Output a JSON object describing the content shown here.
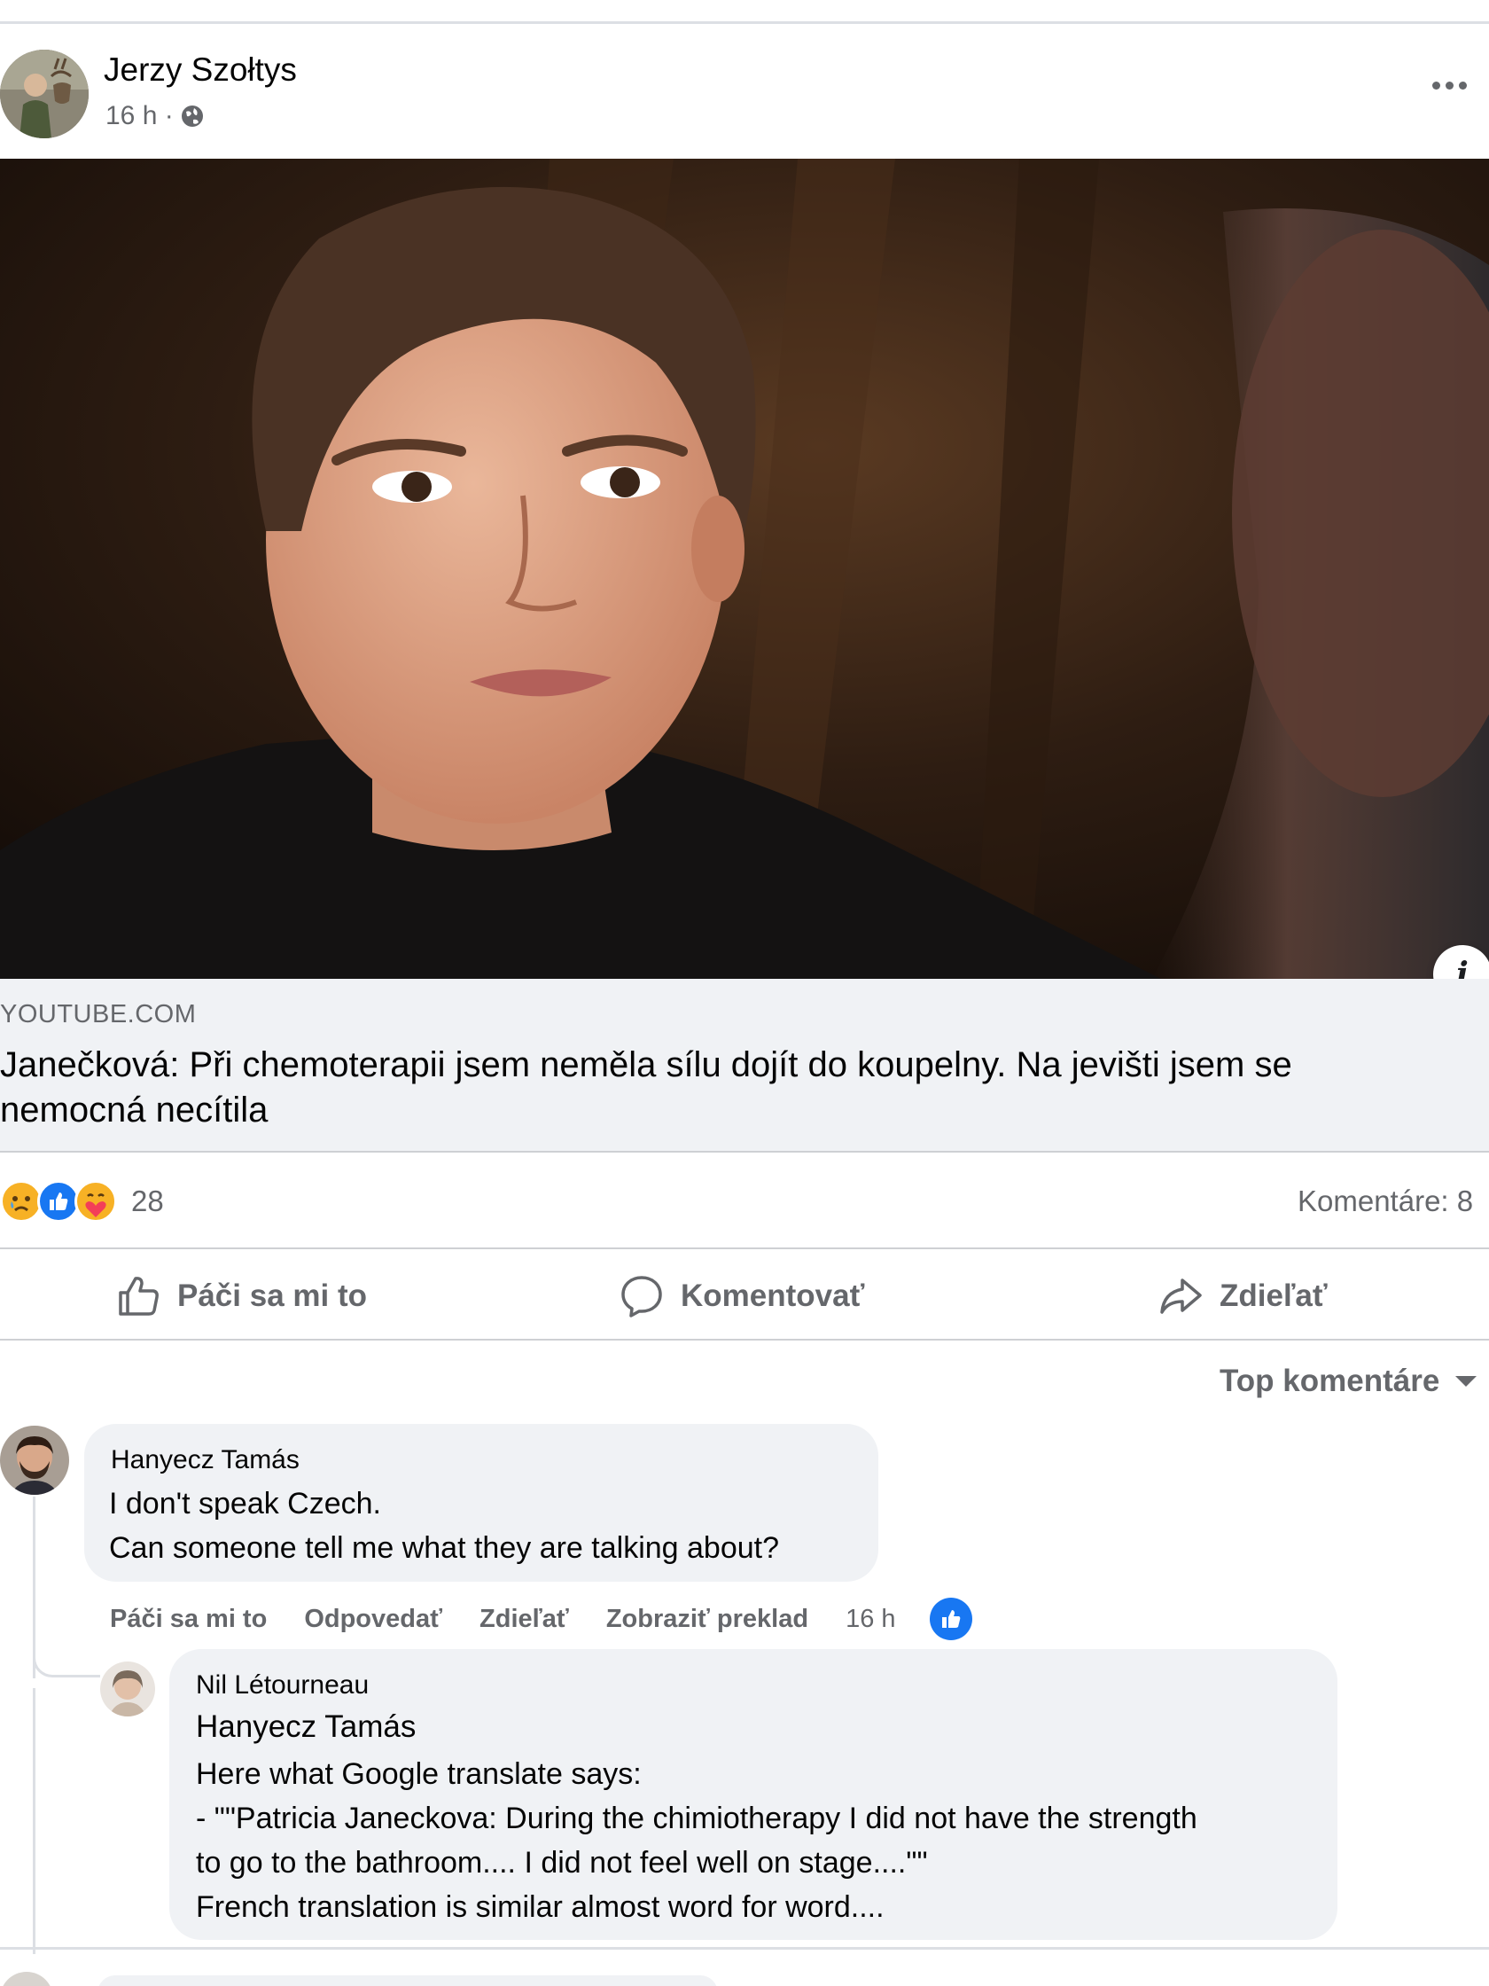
{
  "post": {
    "author": "Jerzy Szołtys",
    "time": "16 h ·",
    "privacy_icon": "globe-icon"
  },
  "link": {
    "domain": "YOUTUBE.COM",
    "title_line1": "Janečková: Při chemoterapii jsem neměla sílu dojít do koupelny. Na jevišti jsem se",
    "title_line2": "nemocná necítila"
  },
  "stats": {
    "reaction_icons": [
      "sad-reaction-icon",
      "like-reaction-icon",
      "care-reaction-icon"
    ],
    "reaction_count": "28",
    "comments_label": "Komentáre: 8"
  },
  "actions": {
    "like": "Páči sa mi to",
    "comment": "Komentovať",
    "share": "Zdieľať"
  },
  "sort_label": "Top komentáre",
  "comments": [
    {
      "author": "Hanyecz Tamás",
      "lines": [
        "I don't speak Czech.",
        "Can someone tell me what they are talking about?"
      ],
      "actions": {
        "like": "Páči sa mi to",
        "reply": "Odpovedať",
        "share": "Zdieľať",
        "translate": "Zobraziť preklad",
        "time": "16 h"
      }
    },
    {
      "author": "Nil Létourneau",
      "mention": "Hanyecz Tamás",
      "lines": [
        "Here what Google translate says:",
        "- \"\"Patricia Janeckova: During the chimiotherapy I did not have the strength",
        "to go to the bathroom.... I did not feel well on stage....\"\"",
        "French translation is similar almost word for word...."
      ]
    }
  ],
  "colors": {
    "brand_blue": "#1877f2",
    "secondary_text": "#65676b",
    "bubble_bg": "#f0f2f5"
  }
}
